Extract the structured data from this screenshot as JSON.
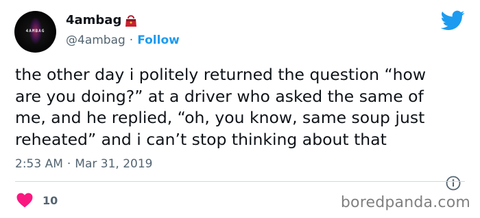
{
  "author": {
    "display_name": "4ambag",
    "handle": "@4ambag",
    "avatar_text": "4AMBAG",
    "follow_label": "Follow",
    "separator": "·"
  },
  "tweet": {
    "text": "the other day i politely returned the question “how\nare you doing?” at a driver who asked the same of\nme, and he replied, “oh, you know, same soup just\nreheated” and i can’t stop thinking about that",
    "time": "2:53 AM",
    "date": "Mar 31, 2019",
    "meta_separator": "·"
  },
  "engagement": {
    "likes": "10"
  },
  "watermark": "boredpanda.com",
  "colors": {
    "twitter_blue": "#1d9bf0",
    "heart_pink": "#f91880",
    "muted_text": "#536471"
  },
  "icons": [
    "twitter-bird-icon",
    "handbag-emoji-icon",
    "info-icon",
    "heart-icon"
  ]
}
